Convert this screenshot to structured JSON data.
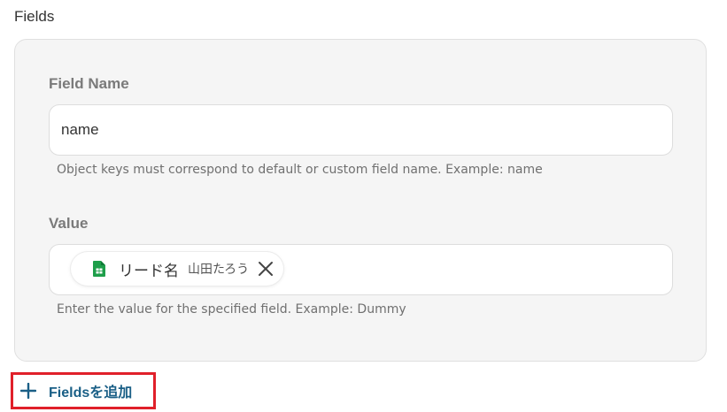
{
  "section": {
    "title": "Fields"
  },
  "field_name": {
    "label": "Field Name",
    "value": "name",
    "help": "Object keys must correspond to default or custom field name. Example: name"
  },
  "value_field": {
    "label": "Value",
    "chip": {
      "icon": "google-sheets-icon",
      "label": "リード名",
      "value": "山田たろう"
    },
    "help": "Enter the value for the specified field. Example: Dummy"
  },
  "add_button": {
    "icon": "plus-icon",
    "label": "Fieldsを追加"
  },
  "colors": {
    "accent_text": "#1a5f86",
    "highlight_border": "#e0202a",
    "sheets_green": "#1e9e4a",
    "card_bg": "#f5f5f5"
  }
}
